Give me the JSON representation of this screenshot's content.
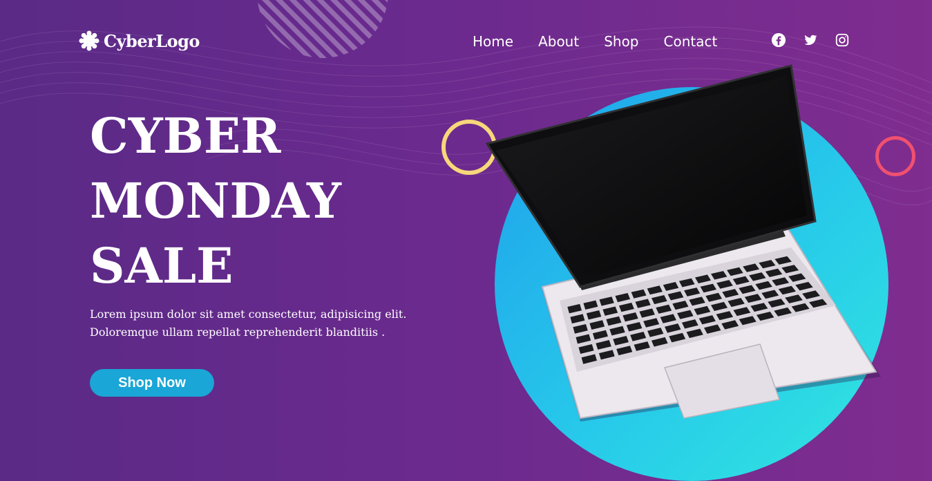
{
  "brand": {
    "name": "CyberLogo",
    "logo_icon": "gear-burst-icon"
  },
  "nav": {
    "items": [
      "Home",
      "About",
      "Shop",
      "Contact"
    ]
  },
  "social": {
    "icons": [
      "facebook-icon",
      "twitter-icon",
      "instagram-icon"
    ]
  },
  "hero": {
    "title_lines": [
      "CYBER",
      "MONDAY",
      "SALE"
    ],
    "description_lines": [
      "Lorem ipsum dolor sit amet consectetur, adipisicing elit.",
      "Doloremque ullam repellat reprehenderit blanditiis ."
    ],
    "cta_label": "Shop Now"
  },
  "colors": {
    "background": "#6a2a8e",
    "accent_button": "#1aa6d6",
    "disc": "#27c9ea",
    "ring_yellow": "#f6d77a",
    "ring_red": "#f0506e"
  }
}
